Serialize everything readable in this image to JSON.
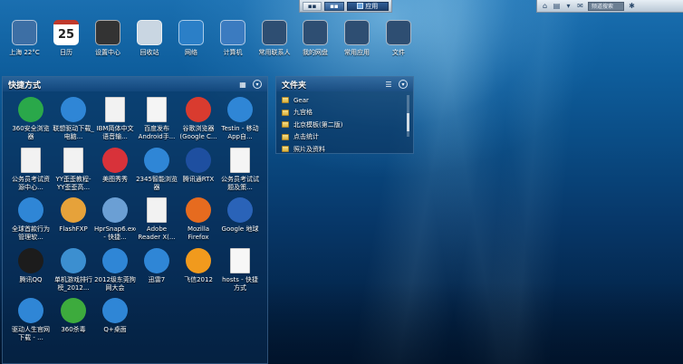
{
  "taskbar": {
    "win_label": "",
    "app_label": "应用"
  },
  "tray": {
    "search_placeholder": "频道搜索",
    "icons": [
      "home-icon",
      "document-icon",
      "shirt-icon",
      "mail-icon",
      "settings-icon"
    ]
  },
  "dock": [
    {
      "label": "上海 22°C",
      "icon": "weather-icon",
      "color": "#3d6fa5"
    },
    {
      "label": "日历",
      "icon": "calendar-icon",
      "color": "#ffffff",
      "text": "25"
    },
    {
      "label": "设置中心",
      "icon": "gear-icon",
      "color": "#333333"
    },
    {
      "label": "回收站",
      "icon": "recycle-bin-icon",
      "color": "#c9d6e2"
    },
    {
      "label": "网络",
      "icon": "network-icon",
      "color": "#2b7fc7"
    },
    {
      "label": "计算机",
      "icon": "computer-icon",
      "color": "#3b7bc0"
    },
    {
      "label": "常用联系人",
      "icon": "contacts-icon",
      "color": "#2e4e72"
    },
    {
      "label": "我的网盘",
      "icon": "cloud-disk-icon",
      "color": "#2e4e72"
    },
    {
      "label": "常用应用",
      "icon": "apps-icon",
      "color": "#2e4e72"
    },
    {
      "label": "文件",
      "icon": "files-icon",
      "color": "#2e4e72"
    }
  ],
  "shortcuts": {
    "title": "快捷方式",
    "items": [
      {
        "label": "360安全浏览器",
        "icon": "360-browser-icon",
        "color": "#2aa84a"
      },
      {
        "label": "联想驱动下载_电脑...",
        "icon": "ie-icon",
        "color": "#2f86d6"
      },
      {
        "label": "IBM简体中文语音输...",
        "icon": "file-icon",
        "color": "#f2f2f2"
      },
      {
        "label": "百度发布Android手...",
        "icon": "doc-icon",
        "color": "#f5f5f5"
      },
      {
        "label": "谷歌浏览器(Google C...",
        "icon": "chrome-icon",
        "color": "#d93b2f"
      },
      {
        "label": "Testin - 移动App自...",
        "icon": "ie-icon",
        "color": "#2f86d6"
      },
      {
        "label": "公务员考试资源中心...",
        "icon": "file-icon",
        "color": "#f2f2f2"
      },
      {
        "label": "YY歪歪教程-YY歪歪高...",
        "icon": "file-icon",
        "color": "#f2f2f2"
      },
      {
        "label": "美图秀秀",
        "icon": "meitu-icon",
        "color": "#d8323a"
      },
      {
        "label": "2345智能浏览器",
        "icon": "2345-browser-icon",
        "color": "#2f86d6"
      },
      {
        "label": "腾讯通RTX",
        "icon": "rtx-icon",
        "color": "#1e4fa0"
      },
      {
        "label": "公务员考试试题及策...",
        "icon": "doc-icon",
        "color": "#f5f5f5"
      },
      {
        "label": "全球首款行为管理软...",
        "icon": "ie-icon",
        "color": "#2f86d6"
      },
      {
        "label": "FlashFXP",
        "icon": "flashfxp-icon",
        "color": "#e6a23a"
      },
      {
        "label": "HprSnap6.exe - 快捷...",
        "icon": "hypersnap-icon",
        "color": "#6b9fd4"
      },
      {
        "label": "Adobe Reader X(...",
        "icon": "file-icon",
        "color": "#f2f2f2"
      },
      {
        "label": "Mozilla Firefox",
        "icon": "firefox-icon",
        "color": "#e66b1f"
      },
      {
        "label": "Google 地球",
        "icon": "google-earth-icon",
        "color": "#2a63b8"
      },
      {
        "label": "腾讯QQ",
        "icon": "qq-icon",
        "color": "#1c1c1c"
      },
      {
        "label": "单机游戏排行榜_2012...",
        "icon": "game-icon",
        "color": "#3c8fd0"
      },
      {
        "label": "2012级东莞狗网大会",
        "icon": "ie-icon",
        "color": "#2f86d6"
      },
      {
        "label": "迅雷7",
        "icon": "thunder-icon",
        "color": "#2f86d6"
      },
      {
        "label": "飞信2012",
        "icon": "fetion-icon",
        "color": "#f19a1d"
      },
      {
        "label": "hosts - 快捷方式",
        "icon": "file-icon",
        "color": "#f7f7f7"
      },
      {
        "label": "驱动人生官网下载 - ...",
        "icon": "ie-icon",
        "color": "#2f86d6"
      },
      {
        "label": "360杀毒",
        "icon": "360-antivirus-icon",
        "color": "#3dab3d"
      },
      {
        "label": "Q+桌面",
        "icon": "qplus-icon",
        "color": "#2f86d6"
      }
    ]
  },
  "folders": {
    "title": "文件夹",
    "items": [
      "Gear",
      "九宫格",
      "北京模板(第二版)",
      "点击统计",
      "照片及资料"
    ]
  },
  "colors": {
    "panel_bg": "#0a2d55",
    "folder_yellow": "#f2cf5e"
  }
}
